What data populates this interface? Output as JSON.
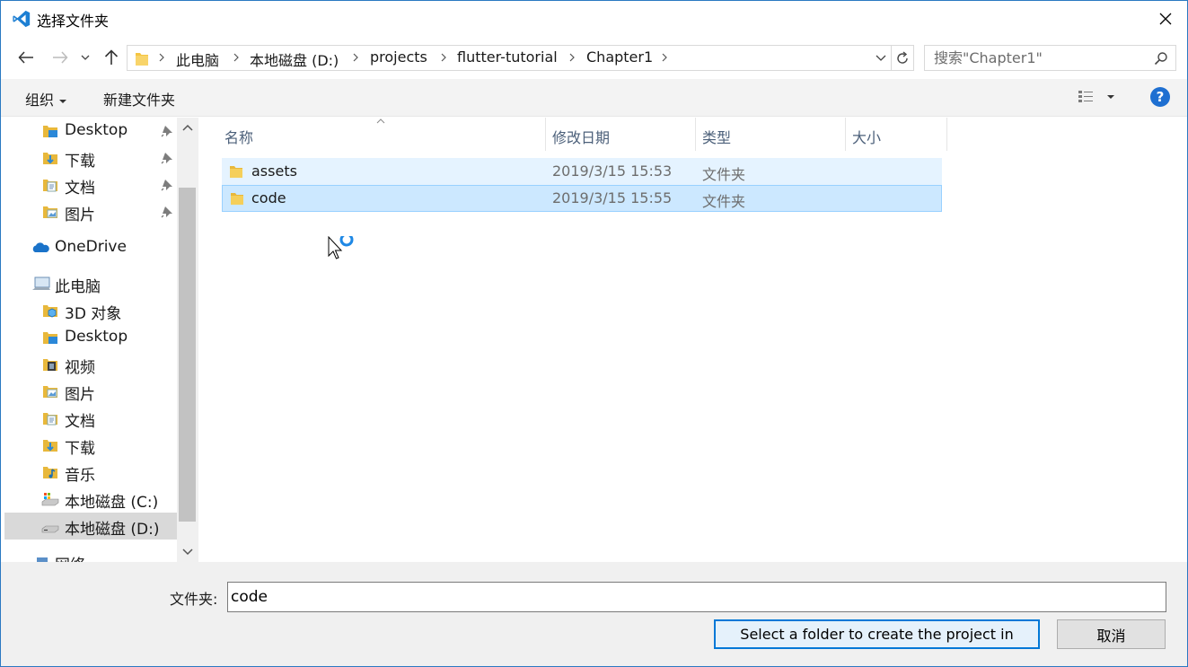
{
  "window": {
    "title": "选择文件夹",
    "accent": "#2b79c2"
  },
  "address": {
    "crumbs": [
      "此电脑",
      "本地磁盘 (D:)",
      "projects",
      "flutter-tutorial",
      "Chapter1"
    ]
  },
  "search": {
    "placeholder": "搜索\"Chapter1\""
  },
  "toolbar": {
    "organize": "组织",
    "new_folder": "新建文件夹",
    "help": "?"
  },
  "nav": {
    "items": [
      {
        "label": "Desktop",
        "icon": "desktop-folder-icon",
        "pinned": true
      },
      {
        "label": "下载",
        "icon": "downloads-folder-icon",
        "pinned": true
      },
      {
        "label": "文档",
        "icon": "documents-folder-icon",
        "pinned": true
      },
      {
        "label": "图片",
        "icon": "pictures-folder-icon",
        "pinned": true
      },
      {
        "label": "OneDrive",
        "icon": "onedrive-cloud-icon"
      },
      {
        "label": "此电脑",
        "icon": "this-pc-icon"
      },
      {
        "label": "3D 对象",
        "icon": "3d-objects-folder-icon"
      },
      {
        "label": "Desktop",
        "icon": "desktop-folder-icon"
      },
      {
        "label": "视频",
        "icon": "videos-folder-icon"
      },
      {
        "label": "图片",
        "icon": "pictures-folder-icon"
      },
      {
        "label": "文档",
        "icon": "documents-folder-icon"
      },
      {
        "label": "下载",
        "icon": "downloads-folder-icon"
      },
      {
        "label": "音乐",
        "icon": "music-folder-icon"
      },
      {
        "label": "本地磁盘 (C:)",
        "icon": "drive-c-icon"
      },
      {
        "label": "本地磁盘 (D:)",
        "icon": "drive-d-icon",
        "selected": true
      },
      {
        "label": "网络",
        "icon": "network-icon"
      }
    ]
  },
  "columns": {
    "name": "名称",
    "date": "修改日期",
    "type": "类型",
    "size": "大小"
  },
  "files": [
    {
      "name": "assets",
      "date": "2019/3/15 15:53",
      "type": "文件夹",
      "size": ""
    },
    {
      "name": "code",
      "date": "2019/3/15 15:55",
      "type": "文件夹",
      "size": ""
    }
  ],
  "footer": {
    "folder_label": "文件夹:",
    "folder_value": "code",
    "select_button": "Select a folder to create the project in",
    "cancel_button": "取消"
  }
}
